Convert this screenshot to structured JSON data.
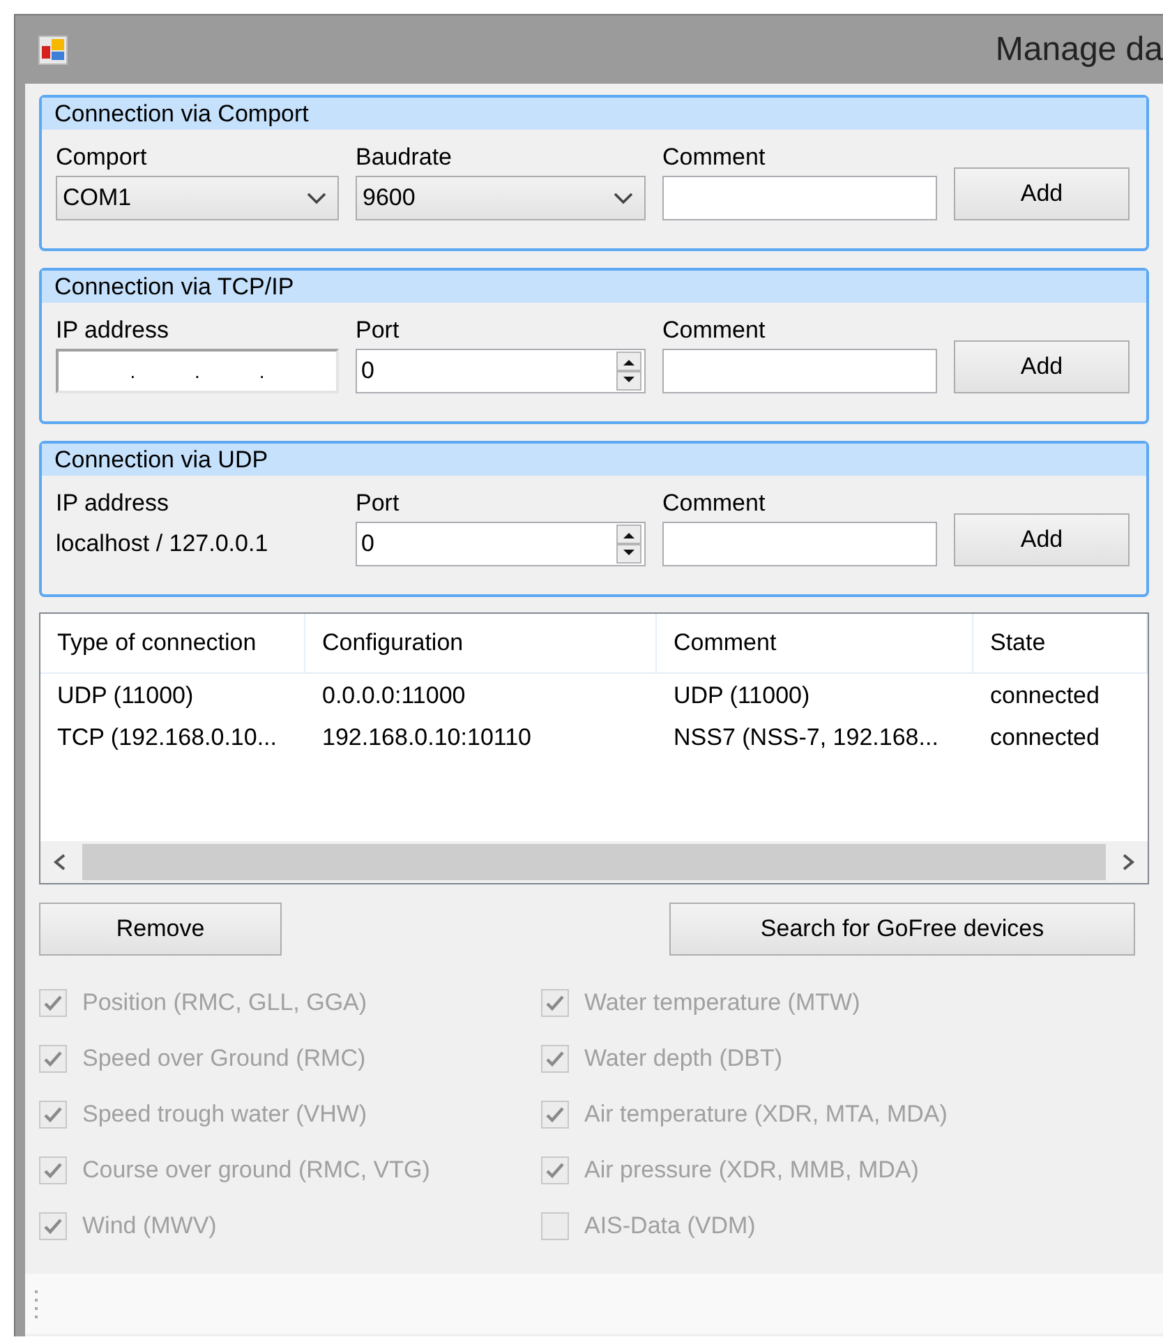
{
  "window": {
    "title": "Manage da"
  },
  "groups": [
    {
      "title": "Connection via Comport",
      "fields": [
        {
          "label": "Comport",
          "kind": "dropdown",
          "value": "COM1"
        },
        {
          "label": "Baudrate",
          "kind": "dropdown",
          "value": "9600"
        },
        {
          "label": "Comment",
          "kind": "text"
        }
      ],
      "button": "Add"
    },
    {
      "title": "Connection via TCP/IP",
      "fields": [
        {
          "label": "IP address",
          "kind": "ip",
          "separators": [
            ".",
            ".",
            "."
          ]
        },
        {
          "label": "Port",
          "kind": "spin",
          "value": "0"
        },
        {
          "label": "Comment",
          "kind": "text"
        }
      ],
      "button": "Add"
    },
    {
      "title": "Connection via UDP",
      "fields": [
        {
          "label": "IP address",
          "kind": "static",
          "value": "localhost / 127.0.0.1"
        },
        {
          "label": "Port",
          "kind": "spin",
          "value": "0"
        },
        {
          "label": "Comment",
          "kind": "text"
        }
      ],
      "button": "Add"
    }
  ],
  "table": {
    "columns": [
      "Type of connection",
      "Configuration",
      "Comment",
      "State"
    ],
    "rows": [
      [
        "UDP (11000)",
        "0.0.0.0:11000",
        "UDP (11000)",
        "connected"
      ],
      [
        "TCP (192.168.0.10...",
        "192.168.0.10:10110",
        "NSS7 (NSS-7, 192.168...",
        "connected"
      ]
    ]
  },
  "buttons": [
    "Remove",
    "Search for GoFree devices"
  ],
  "option_columns": [
    {
      "items": [
        {
          "label": "Position (RMC, GLL, GGA)",
          "checked": true,
          "disabled": true
        },
        {
          "label": "Speed over Ground (RMC)",
          "checked": true,
          "disabled": true
        },
        {
          "label": "Speed trough water (VHW)",
          "checked": true,
          "disabled": true
        },
        {
          "label": "Course over ground (RMC, VTG)",
          "checked": true,
          "disabled": true
        },
        {
          "label": "Wind (MWV)",
          "checked": true,
          "disabled": true
        }
      ]
    },
    {
      "items": [
        {
          "label": "Water temperature (MTW)",
          "checked": true,
          "disabled": true
        },
        {
          "label": "Water depth (DBT)",
          "checked": true,
          "disabled": true
        },
        {
          "label": "Air temperature (XDR, MTA, MDA)",
          "checked": true,
          "disabled": true
        },
        {
          "label": "Air pressure (XDR, MMB, MDA)",
          "checked": true,
          "disabled": true
        },
        {
          "label": "AIS-Data (VDM)",
          "checked": false,
          "disabled": true
        }
      ]
    }
  ]
}
